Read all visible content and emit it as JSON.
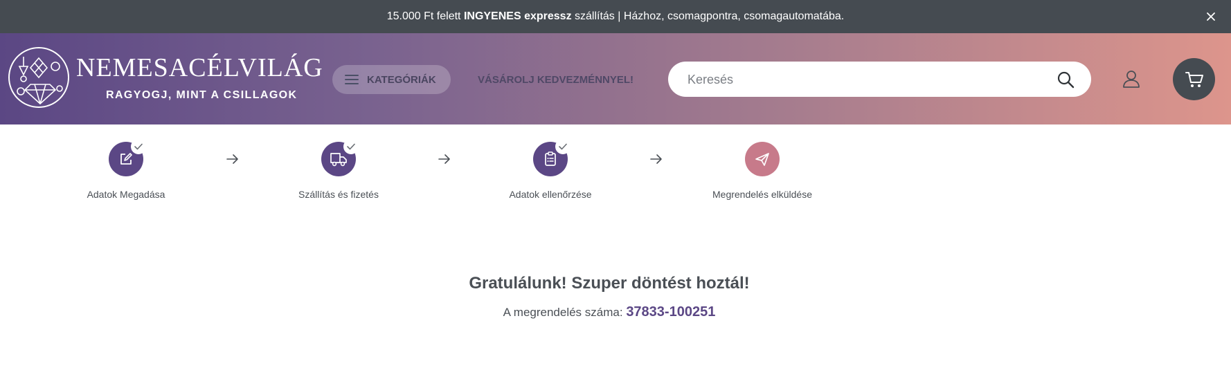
{
  "announcement": {
    "part1": "15.000 Ft felett ",
    "part2": "INGYENES expressz",
    "part3": " szállítás | Házhoz, csomagpontra, csomagautomatába.",
    "close_icon": "close-icon"
  },
  "header": {
    "logo_name": "NEMESACÉLVILÁG",
    "logo_tagline": "RAGYOGJ, MINT A CSILLAGOK",
    "categories_label": "KATEGÓRIÁK",
    "promo_label": "VÁSÁROLJ KEDVEZMÉNNYEL!",
    "search_placeholder": "Keresés",
    "icons": [
      "menu-icon",
      "search-icon",
      "user-icon",
      "cart-icon"
    ]
  },
  "checkout_steps": [
    {
      "label": "Adatok Megadása",
      "icon": "edit-icon",
      "status": "completed"
    },
    {
      "label": "Szállítás és fizetés",
      "icon": "truck-icon",
      "status": "completed"
    },
    {
      "label": "Adatok ellenőrzése",
      "icon": "clipboard-icon",
      "status": "completed"
    },
    {
      "label": "Megrendelés elküldése",
      "icon": "send-icon",
      "status": "active"
    }
  ],
  "confirmation": {
    "title": "Gratulálunk! Szuper döntést hoztál!",
    "order_label": "A megrendelés száma: ",
    "order_number": "37833-100251"
  },
  "colors": {
    "topbar": "#454b51",
    "gradient_start": "#5b4784",
    "gradient_end": "#dd958c",
    "step_done": "#5b4785",
    "step_active": "#c77a8a",
    "text": "#4a4f55"
  }
}
